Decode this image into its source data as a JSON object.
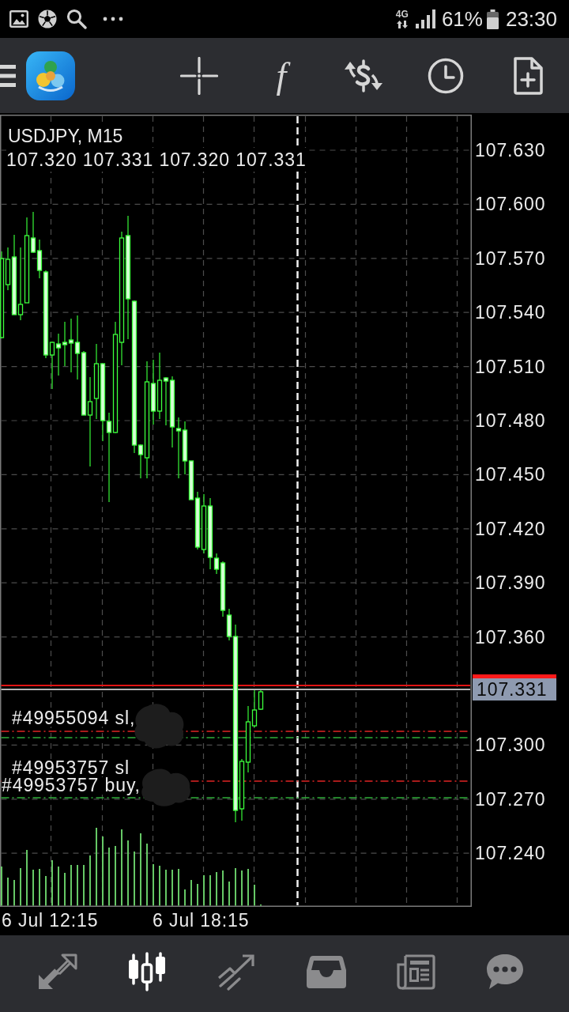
{
  "status_bar": {
    "network": "4G",
    "battery": "61%",
    "time": "23:30"
  },
  "toolbar": {
    "indicator_symbol": "f"
  },
  "chart": {
    "symbol": "USDJPY, M15",
    "ohlc": "107.320 107.331 107.320 107.331",
    "order_labels": [
      {
        "text": "#49955094 sl,",
        "redacted": true
      },
      {
        "text": "#49953757 sl",
        "redacted": false
      },
      {
        "text": "#49953757 buy,",
        "redacted": true
      }
    ],
    "price_axis": [
      {
        "kind": "tick",
        "text": "107.630"
      },
      {
        "kind": "tick",
        "text": "107.600"
      },
      {
        "kind": "tick",
        "text": "107.570"
      },
      {
        "kind": "tick",
        "text": "107.540"
      },
      {
        "kind": "tick",
        "text": "107.510"
      },
      {
        "kind": "tick",
        "text": "107.480"
      },
      {
        "kind": "tick",
        "text": "107.450"
      },
      {
        "kind": "tick",
        "text": "107.420"
      },
      {
        "kind": "tick",
        "text": "107.390"
      },
      {
        "kind": "tick",
        "text": "107.360"
      },
      {
        "kind": "current",
        "text": "107.331"
      },
      {
        "kind": "tick",
        "text": "107.300"
      },
      {
        "kind": "tick",
        "text": "107.270"
      },
      {
        "kind": "tick",
        "text": "107.240"
      }
    ],
    "time_labels": [
      "6 Jul 12:15",
      "6 Jul 18:15"
    ]
  },
  "bottom_nav": [
    {
      "kind": "arrows",
      "selected": false
    },
    {
      "kind": "candles",
      "selected": true
    },
    {
      "kind": "trend",
      "selected": false
    },
    {
      "kind": "inbox",
      "selected": false
    },
    {
      "kind": "newspaper",
      "selected": false
    },
    {
      "kind": "chat",
      "selected": false
    }
  ]
}
